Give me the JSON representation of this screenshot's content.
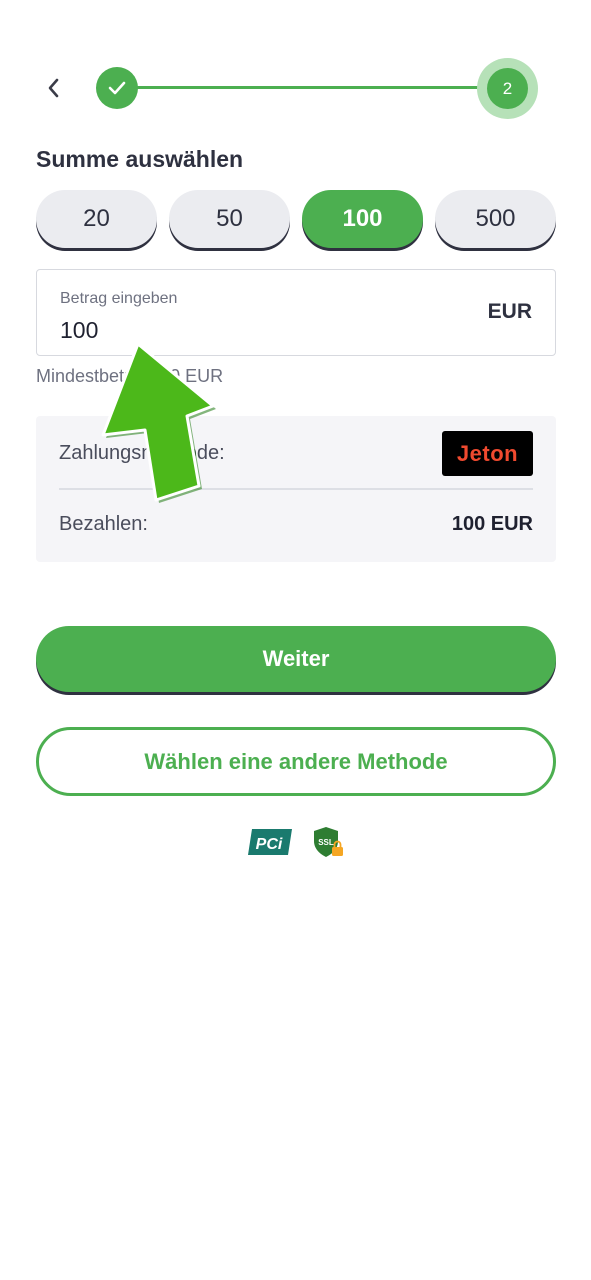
{
  "stepper": {
    "step2_number": "2"
  },
  "title": "Summe auswählen",
  "amount_chips": [
    {
      "label": "20"
    },
    {
      "label": "50"
    },
    {
      "label": "100",
      "selected": true
    },
    {
      "label": "500"
    }
  ],
  "amount_field": {
    "label": "Betrag eingeben",
    "value": "100",
    "currency": "EUR"
  },
  "min_hint": "Mindestbetrag: 10 EUR",
  "summary": {
    "method_label": "Zahlungsmethode:",
    "method_logo_text": "Jeton",
    "pay_label": "Bezahlen:",
    "pay_value": "100 EUR"
  },
  "buttons": {
    "continue": "Weiter",
    "other_method": "Wählen eine andere Methode"
  },
  "badges": {
    "pci": "PCi",
    "ssl": "SSL"
  },
  "colors": {
    "accent": "#4caf50",
    "accent_light": "#b6e1b8",
    "jeton_red": "#f04a2f",
    "pci_teal": "#1a7a6e",
    "ssl_green": "#2e7d32",
    "lock_orange": "#f5a623"
  }
}
